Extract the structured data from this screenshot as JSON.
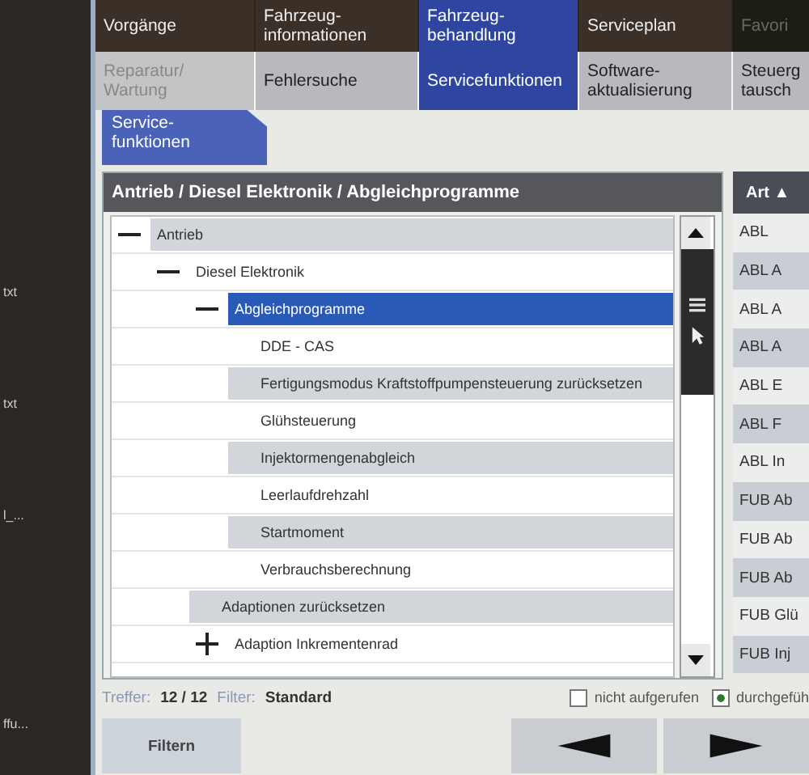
{
  "desktop_labels": [
    "txt",
    "txt",
    "l_...",
    "ffu..."
  ],
  "main_tabs": [
    {
      "label": "Vorgänge",
      "selected": false,
      "disabled": false
    },
    {
      "label": "Fahrzeug-\ninformationen",
      "selected": false,
      "disabled": false
    },
    {
      "label": "Fahrzeug-\nbehandlung",
      "selected": true,
      "disabled": false
    },
    {
      "label": "Serviceplan",
      "selected": false,
      "disabled": false
    },
    {
      "label": "Favori",
      "selected": false,
      "disabled": true
    }
  ],
  "sub_tabs": [
    {
      "label": "Reparatur/\nWartung",
      "selected": false,
      "disabled": true
    },
    {
      "label": "Fehlersuche",
      "selected": false,
      "disabled": false
    },
    {
      "label": "Servicefunktionen",
      "selected": true,
      "disabled": false
    },
    {
      "label": "Software-\naktualisierung",
      "selected": false,
      "disabled": false
    },
    {
      "label": "Steuerg\ntausch",
      "selected": false,
      "disabled": false
    }
  ],
  "section_tab": {
    "label": "Service-\nfunktionen",
    "selected": true
  },
  "breadcrumb": "Antrieb / Diesel Elektronik / Abgleichprogramme",
  "tree": [
    {
      "label": "Antrieb",
      "expanded": true,
      "selected": false,
      "children": [
        {
          "label": "Diesel Elektronik",
          "expanded": true,
          "selected": false,
          "children": [
            {
              "label": "Abgleichprogramme",
              "expanded": true,
              "selected": true,
              "children": [
                {
                  "label": "DDE - CAS",
                  "selected": false
                },
                {
                  "label": "Fertigungsmodus Kraftstoffpumpensteuerung zurücksetzen",
                  "selected": false
                },
                {
                  "label": "Glühsteuerung",
                  "selected": false
                },
                {
                  "label": "Injektormengenabgleich",
                  "selected": false
                },
                {
                  "label": "Leerlaufdrehzahl",
                  "selected": false
                },
                {
                  "label": "Startmoment",
                  "selected": false
                },
                {
                  "label": "Verbrauchsberechnung",
                  "selected": false
                }
              ]
            },
            {
              "label": "Adaptionen zurücksetzen",
              "selected": false
            },
            {
              "label": "Adaption Inkrementenrad",
              "expanded": false,
              "selected": false
            }
          ]
        }
      ]
    }
  ],
  "art_column": {
    "header": "Art ▲",
    "rows": [
      "ABL",
      "ABL A",
      "ABL A",
      "ABL A",
      "ABL E",
      "ABL F",
      "ABL In",
      "FUB Ab",
      "FUB Ab",
      "FUB Ab",
      "FUB Glü",
      "FUB Inj"
    ]
  },
  "status": {
    "hits_label": "Treffer:",
    "hits": "12 / 12",
    "filter_label": "Filter:",
    "filter": "Standard"
  },
  "legend": [
    {
      "label": "nicht aufgerufen",
      "checked": false
    },
    {
      "label": "durchgefüh",
      "checked": true
    }
  ],
  "buttons": {
    "filter": "Filtern"
  }
}
